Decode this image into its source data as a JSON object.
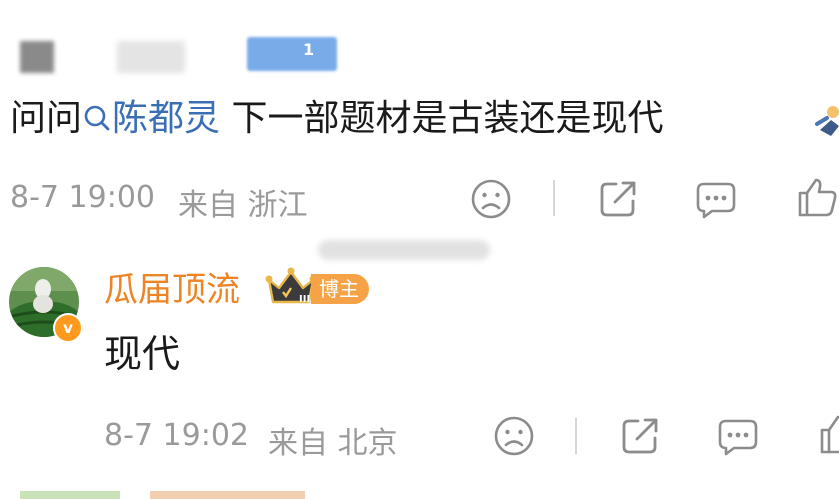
{
  "post": {
    "level_badge": "1",
    "text_prefix": "问问",
    "mention": "陈都灵",
    "text_suffix": " 下一部题材是古装还是现代",
    "time": "8-7 19:00",
    "source": "来自 浙江",
    "icons": [
      "sad-face-icon",
      "share-icon",
      "comment-icon",
      "like-icon",
      "search-icon"
    ]
  },
  "reply": {
    "username": "瓜届顶流",
    "role_badge": "博主",
    "crown_level": "III",
    "verified_badge": "v",
    "text": "现代",
    "time": "8-7 19:02",
    "source": "来自 北京",
    "icons": [
      "sad-face-icon",
      "share-icon",
      "comment-icon",
      "like-icon"
    ]
  },
  "colors": {
    "mention": "#3b6fb5",
    "username": "#ee8424",
    "meta_text": "#9a9a9a",
    "badge": "#f6a347",
    "level_badge": "#79abe9"
  }
}
